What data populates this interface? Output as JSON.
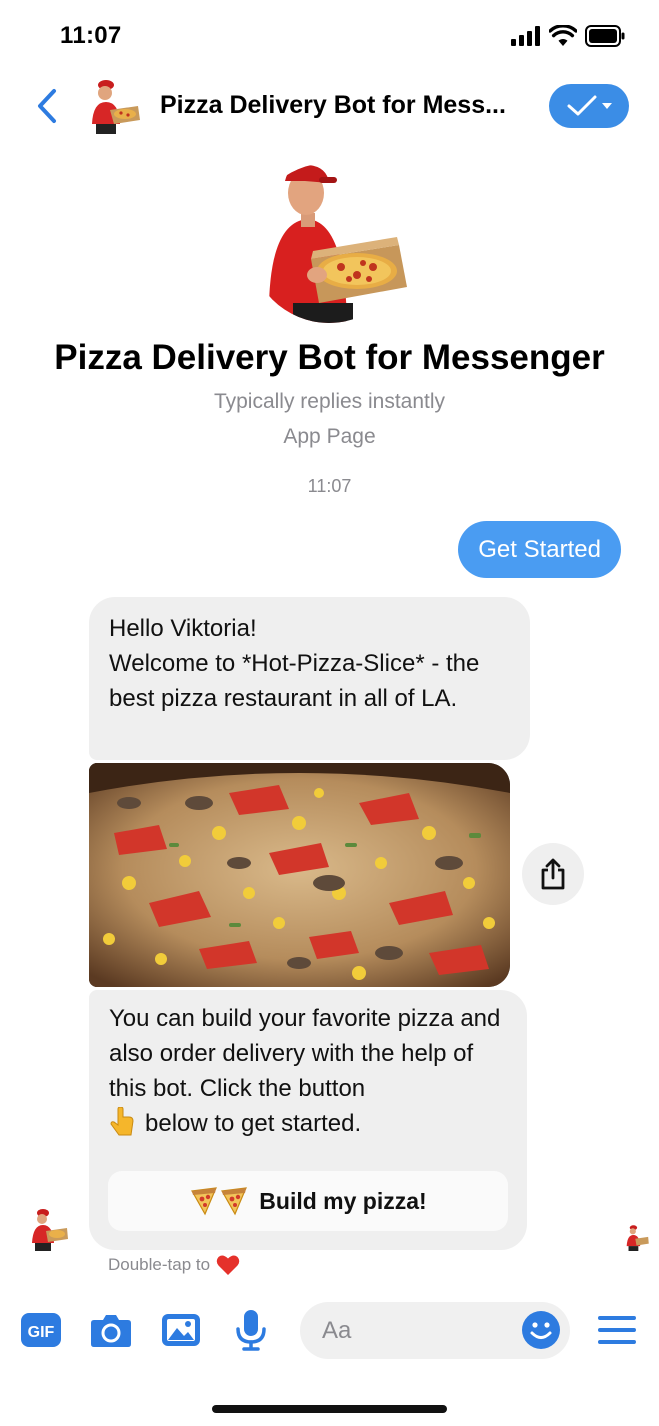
{
  "status_bar": {
    "time": "11:07"
  },
  "header": {
    "title": "Pizza Delivery Bot for Mess..."
  },
  "profile": {
    "name": "Pizza Delivery Bot for Messenger",
    "subtitle": "Typically replies instantly",
    "category": "App Page"
  },
  "conversation": {
    "timestamp": "11:07",
    "outgoing_message": "Get Started",
    "bot_message_1": "Hello Viktoria!\nWelcome to *Hot-Pizza-Slice* - the best pizza restaurant in all of LA.",
    "bot_message_2_before_emoji": "You can build your favorite pizza and also order delivery with the help of this bot. Click the button",
    "bot_message_2_after_emoji": "below to get started.",
    "quick_reply_button": "Build my pizza!",
    "reaction_hint": "Double-tap to"
  },
  "composer": {
    "input_placeholder": "Aa",
    "gif_label": "GIF"
  },
  "colors": {
    "accent": "#4a9cf2",
    "bubble_gray": "#efefef",
    "muted_text": "#8a8a8f",
    "icon_blue": "#2d7be0"
  },
  "icons": [
    "back-icon",
    "checkmark-icon",
    "share-icon",
    "gif-icon",
    "camera-icon",
    "photo-icon",
    "microphone-icon",
    "emoji-icon",
    "menu-icon",
    "pointing-down-emoji",
    "pizza-emoji",
    "heart-emoji"
  ]
}
